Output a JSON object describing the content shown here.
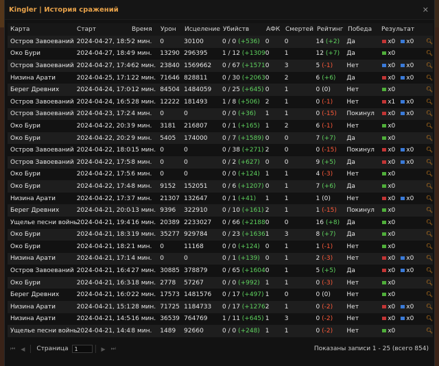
{
  "window": {
    "title": "Kingler | История сражений",
    "close": "✕"
  },
  "columns": {
    "map": "Карта",
    "start": "Старт",
    "time": "Время",
    "damage": "Урон",
    "heal": "Исцеление",
    "kills": "Убийств",
    "afk": "АФК",
    "deaths": "Смертей",
    "rating": "Рейтинг",
    "win": "Победа",
    "result": "Результат"
  },
  "rows": [
    {
      "map": "Остров Завоеваний",
      "start": "2024-04-27, 18:50",
      "time": "2 мин.",
      "damage": "0",
      "heal": "30100",
      "kills_base": "0 / 0",
      "kills_delta": "(+536)",
      "afk": "0",
      "deaths": "0",
      "rating_base": "14",
      "rating_delta": "(+2)",
      "rating_sign": "pos",
      "win": "Да",
      "res": [
        {
          "c": "r",
          "t": "x0"
        },
        {
          "c": "b",
          "t": "x0"
        }
      ]
    },
    {
      "map": "Око Бури",
      "start": "2024-04-27, 18:49",
      "time": "9 мин.",
      "damage": "13290",
      "heal": "296395",
      "kills_base": "1 / 12",
      "kills_delta": "(+1309)",
      "afk": "0",
      "deaths": "1",
      "rating_base": "12",
      "rating_delta": "(+7)",
      "rating_sign": "pos",
      "win": "Да",
      "res": [
        {
          "c": "g",
          "t": "x0"
        }
      ]
    },
    {
      "map": "Остров Завоеваний",
      "start": "2024-04-27, 17:40",
      "time": "62 мин.",
      "damage": "23840",
      "heal": "1569662",
      "kills_base": "0 / 67",
      "kills_delta": "(+1571)",
      "afk": "0",
      "deaths": "3",
      "rating_base": "5",
      "rating_delta": "(-1)",
      "rating_sign": "neg",
      "win": "Нет",
      "res": [
        {
          "c": "b",
          "t": "x0"
        },
        {
          "c": "b",
          "t": "x0"
        }
      ]
    },
    {
      "map": "Низина Арати",
      "start": "2024-04-25, 17:15",
      "time": "22 мин.",
      "damage": "71646",
      "heal": "828811",
      "kills_base": "0 / 30",
      "kills_delta": "(+2063)",
      "afk": "0",
      "deaths": "2",
      "rating_base": "6",
      "rating_delta": "(+6)",
      "rating_sign": "pos",
      "win": "Да",
      "res": [
        {
          "c": "r",
          "t": "x0"
        },
        {
          "c": "b",
          "t": "x0"
        }
      ]
    },
    {
      "map": "Берег Древних",
      "start": "2024-04-24, 17:06",
      "time": "12 мин.",
      "damage": "84504",
      "heal": "1484059",
      "kills_base": "0 / 25",
      "kills_delta": "(+645)",
      "afk": "0",
      "deaths": "1",
      "rating_base": "0",
      "rating_delta": "(0)",
      "rating_sign": "neu",
      "win": "Нет",
      "res": [
        {
          "c": "g",
          "t": "x0"
        }
      ]
    },
    {
      "map": "Остров Завоеваний",
      "start": "2024-04-24, 16:53",
      "time": "28 мин.",
      "damage": "12222",
      "heal": "181493",
      "kills_base": "1 / 8",
      "kills_delta": "(+506)",
      "afk": "2",
      "deaths": "1",
      "rating_base": "0",
      "rating_delta": "(-1)",
      "rating_sign": "neg",
      "win": "Нет",
      "res": [
        {
          "c": "r",
          "t": "x1"
        },
        {
          "c": "b",
          "t": "x0"
        }
      ]
    },
    {
      "map": "Остров Завоеваний",
      "start": "2024-04-23, 17:25",
      "time": "4 мин.",
      "damage": "0",
      "heal": "0",
      "kills_base": "0 / 0",
      "kills_delta": "(+36)",
      "afk": "1",
      "deaths": "1",
      "rating_base": "0",
      "rating_delta": "(-15)",
      "rating_sign": "neg",
      "win": "Покинул",
      "res": [
        {
          "c": "r",
          "t": "x0"
        },
        {
          "c": "b",
          "t": "x0"
        }
      ]
    },
    {
      "map": "Око Бури",
      "start": "2024-04-22, 20:31",
      "time": "9 мин.",
      "damage": "3181",
      "heal": "216807",
      "kills_base": "0 / 1",
      "kills_delta": "(+165)",
      "afk": "1",
      "deaths": "2",
      "rating_base": "6",
      "rating_delta": "(-1)",
      "rating_sign": "neg",
      "win": "Нет",
      "res": [
        {
          "c": "g",
          "t": "x0"
        }
      ]
    },
    {
      "map": "Око Бури",
      "start": "2024-04-22, 20:21",
      "time": "9 мин.",
      "damage": "5405",
      "heal": "174000",
      "kills_base": "0 / 7",
      "kills_delta": "(+1589)",
      "afk": "0",
      "deaths": "0",
      "rating_base": "7",
      "rating_delta": "(+7)",
      "rating_sign": "pos",
      "win": "Да",
      "res": [
        {
          "c": "g",
          "t": "x0"
        }
      ]
    },
    {
      "map": "Остров Завоеваний",
      "start": "2024-04-22, 18:08",
      "time": "15 мин.",
      "damage": "0",
      "heal": "0",
      "kills_base": "0 / 38",
      "kills_delta": "(+271)",
      "afk": "2",
      "deaths": "0",
      "rating_base": "0",
      "rating_delta": "(-15)",
      "rating_sign": "neg",
      "win": "Покинул",
      "res": [
        {
          "c": "r",
          "t": "x0"
        },
        {
          "c": "b",
          "t": "x0"
        }
      ]
    },
    {
      "map": "Остров Завоеваний",
      "start": "2024-04-22, 17:58",
      "time": "8 мин.",
      "damage": "0",
      "heal": "0",
      "kills_base": "0 / 2",
      "kills_delta": "(+627)",
      "afk": "0",
      "deaths": "0",
      "rating_base": "9",
      "rating_delta": "(+5)",
      "rating_sign": "pos",
      "win": "Да",
      "res": [
        {
          "c": "r",
          "t": "x0"
        },
        {
          "c": "b",
          "t": "x0"
        }
      ]
    },
    {
      "map": "Око Бури",
      "start": "2024-04-22, 17:52",
      "time": "6 мин.",
      "damage": "0",
      "heal": "0",
      "kills_base": "0 / 0",
      "kills_delta": "(+124)",
      "afk": "1",
      "deaths": "1",
      "rating_base": "4",
      "rating_delta": "(-3)",
      "rating_sign": "neg",
      "win": "Нет",
      "res": [
        {
          "c": "g",
          "t": "x0"
        }
      ]
    },
    {
      "map": "Око Бури",
      "start": "2024-04-22, 17:44",
      "time": "8 мин.",
      "damage": "9152",
      "heal": "152051",
      "kills_base": "0 / 6",
      "kills_delta": "(+1207)",
      "afk": "0",
      "deaths": "1",
      "rating_base": "7",
      "rating_delta": "(+6)",
      "rating_sign": "pos",
      "win": "Да",
      "res": [
        {
          "c": "g",
          "t": "x0"
        }
      ]
    },
    {
      "map": "Низина Арати",
      "start": "2024-04-22, 17:35",
      "time": "7 мин.",
      "damage": "21307",
      "heal": "132647",
      "kills_base": "0 / 1",
      "kills_delta": "(+41)",
      "afk": "1",
      "deaths": "1",
      "rating_base": "1",
      "rating_delta": "(0)",
      "rating_sign": "neu",
      "win": "Нет",
      "res": [
        {
          "c": "r",
          "t": "x0"
        },
        {
          "c": "b",
          "t": "x0"
        }
      ]
    },
    {
      "map": "Берег Древних",
      "start": "2024-04-21, 20:04",
      "time": "13 мин.",
      "damage": "9396",
      "heal": "322910",
      "kills_base": "0 / 10",
      "kills_delta": "(+161)",
      "afk": "2",
      "deaths": "1",
      "rating_base": "1",
      "rating_delta": "(-15)",
      "rating_sign": "neg",
      "win": "Покинул",
      "res": [
        {
          "c": "g",
          "t": "x0"
        }
      ]
    },
    {
      "map": "Ущелье песни войны",
      "start": "2024-04-21, 19:47",
      "time": "16 мин.",
      "damage": "20389",
      "heal": "2233027",
      "kills_base": "0 / 66",
      "kills_delta": "(+2188)",
      "afk": "0",
      "deaths": "0",
      "rating_base": "16",
      "rating_delta": "(+8)",
      "rating_sign": "pos",
      "win": "Да",
      "res": [
        {
          "c": "g",
          "t": "x0"
        }
      ]
    },
    {
      "map": "Око Бури",
      "start": "2024-04-21, 18:33",
      "time": "19 мин.",
      "damage": "35277",
      "heal": "929784",
      "kills_base": "0 / 23",
      "kills_delta": "(+1636)",
      "afk": "1",
      "deaths": "3",
      "rating_base": "8",
      "rating_delta": "(+7)",
      "rating_sign": "pos",
      "win": "Да",
      "res": [
        {
          "c": "g",
          "t": "x0"
        }
      ]
    },
    {
      "map": "Око Бури",
      "start": "2024-04-21, 18:22",
      "time": "1 мин.",
      "damage": "0",
      "heal": "11168",
      "kills_base": "0 / 0",
      "kills_delta": "(+124)",
      "afk": "0",
      "deaths": "1",
      "rating_base": "1",
      "rating_delta": "(-1)",
      "rating_sign": "neg",
      "win": "Нет",
      "res": [
        {
          "c": "g",
          "t": "x0"
        }
      ]
    },
    {
      "map": "Низина Арати",
      "start": "2024-04-21, 17:17",
      "time": "4 мин.",
      "damage": "0",
      "heal": "0",
      "kills_base": "0 / 1",
      "kills_delta": "(+139)",
      "afk": "0",
      "deaths": "1",
      "rating_base": "2",
      "rating_delta": "(-3)",
      "rating_sign": "neg",
      "win": "Нет",
      "res": [
        {
          "c": "r",
          "t": "x0"
        },
        {
          "c": "b",
          "t": "x0"
        }
      ]
    },
    {
      "map": "Остров Завоеваний",
      "start": "2024-04-21, 16:47",
      "time": "27 мин.",
      "damage": "30885",
      "heal": "378879",
      "kills_base": "0 / 65",
      "kills_delta": "(+1604)",
      "afk": "0",
      "deaths": "1",
      "rating_base": "5",
      "rating_delta": "(+5)",
      "rating_sign": "pos",
      "win": "Да",
      "res": [
        {
          "c": "r",
          "t": "x0"
        },
        {
          "c": "b",
          "t": "x0"
        }
      ]
    },
    {
      "map": "Око Бури",
      "start": "2024-04-21, 16:34",
      "time": "18 мин.",
      "damage": "2778",
      "heal": "57267",
      "kills_base": "0 / 0",
      "kills_delta": "(+992)",
      "afk": "1",
      "deaths": "1",
      "rating_base": "0",
      "rating_delta": "(-3)",
      "rating_sign": "neg",
      "win": "Нет",
      "res": [
        {
          "c": "g",
          "t": "x0"
        }
      ]
    },
    {
      "map": "Берег Древних",
      "start": "2024-04-21, 16:09",
      "time": "22 мин.",
      "damage": "17573",
      "heal": "1481576",
      "kills_base": "0 / 17",
      "kills_delta": "(+497)",
      "afk": "1",
      "deaths": "0",
      "rating_base": "0",
      "rating_delta": "(0)",
      "rating_sign": "neu",
      "win": "Нет",
      "res": [
        {
          "c": "g",
          "t": "x0"
        }
      ]
    },
    {
      "map": "Низина Арати",
      "start": "2024-04-21, 15:12",
      "time": "28 мин.",
      "damage": "71725",
      "heal": "1184733",
      "kills_base": "0 / 17",
      "kills_delta": "(+1276)",
      "afk": "2",
      "deaths": "1",
      "rating_base": "0",
      "rating_delta": "(-2)",
      "rating_sign": "neg",
      "win": "Нет",
      "res": [
        {
          "c": "r",
          "t": "x0"
        },
        {
          "c": "b",
          "t": "x0"
        }
      ]
    },
    {
      "map": "Низина Арати",
      "start": "2024-04-21, 14:54",
      "time": "16 мин.",
      "damage": "36539",
      "heal": "764769",
      "kills_base": "1 / 11",
      "kills_delta": "(+645)",
      "afk": "1",
      "deaths": "3",
      "rating_base": "0",
      "rating_delta": "(-2)",
      "rating_sign": "neg",
      "win": "Нет",
      "res": [
        {
          "c": "r",
          "t": "x0"
        },
        {
          "c": "b",
          "t": "x0"
        }
      ]
    },
    {
      "map": "Ущелье песни войны",
      "start": "2024-04-21, 14:45",
      "time": "8 мин.",
      "damage": "1489",
      "heal": "92660",
      "kills_base": "0 / 0",
      "kills_delta": "(+248)",
      "afk": "1",
      "deaths": "1",
      "rating_base": "0",
      "rating_delta": "(-2)",
      "rating_sign": "neg",
      "win": "Нет",
      "res": [
        {
          "c": "g",
          "t": "x0"
        }
      ]
    }
  ],
  "pager": {
    "first": "⏮",
    "prev": "◀",
    "label": "Страница",
    "page": "1",
    "next": "▶",
    "last": "⏭"
  },
  "summary": "Показаны записи 1 - 25 (всего 854)",
  "colors": {
    "accent": "#e8a24a",
    "positive": "#5fd35f",
    "negative": "#ff5a3a",
    "team_red": "#c23535",
    "team_blue": "#3a7ad8",
    "team_green": "#4fae3a"
  }
}
